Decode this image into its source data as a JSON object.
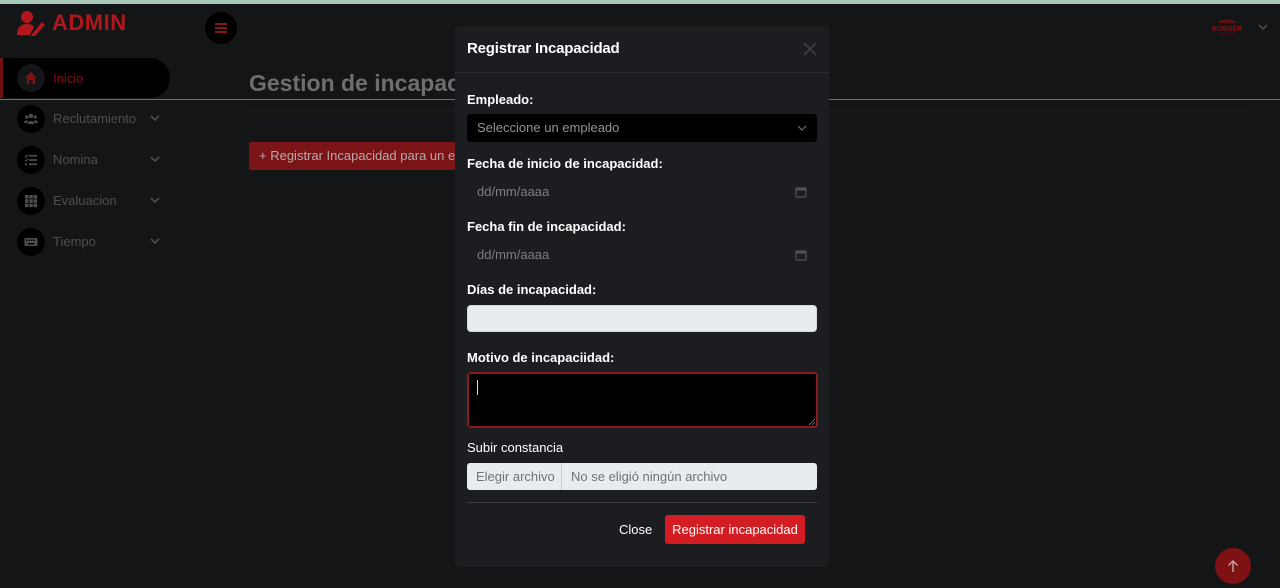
{
  "app": {
    "brand": "ADMIN"
  },
  "sidebar": {
    "items": [
      {
        "label": "Inicio",
        "icon": "home-icon",
        "active": true
      },
      {
        "label": "Reclutamiento",
        "icon": "users-icon"
      },
      {
        "label": "Nomina",
        "icon": "list-icon"
      },
      {
        "label": "Evaluacion",
        "icon": "grid-icon"
      },
      {
        "label": "Tiempo",
        "icon": "keyboard-icon"
      }
    ]
  },
  "main": {
    "title": "Gestion de incapac",
    "add_button": "+ Registrar Incapacidad para un em"
  },
  "header": {
    "logo_text": "BURGER"
  },
  "modal": {
    "title": "Registrar Incapacidad",
    "employee_label": "Empleado:",
    "employee_placeholder": "Seleccione un empleado",
    "start_label": "Fecha de inicio de incapacidad:",
    "start_placeholder": "dd/mm/aaaa",
    "end_label": "Fecha fin de incapacidad:",
    "end_placeholder": "dd/mm/aaaa",
    "days_label": "Días de incapacidad:",
    "days_value": "",
    "reason_label": "Motivo de incapaciidad:",
    "reason_value": "",
    "upload_label": "Subir constancia",
    "file_button": "Elegir archivo",
    "file_status": "No se eligió ningún archivo",
    "close_button": "Close",
    "submit_button": "Registrar incapacidad"
  },
  "colors": {
    "accent": "#d41d22",
    "background": "#141516",
    "modal": "#1b1d21"
  }
}
